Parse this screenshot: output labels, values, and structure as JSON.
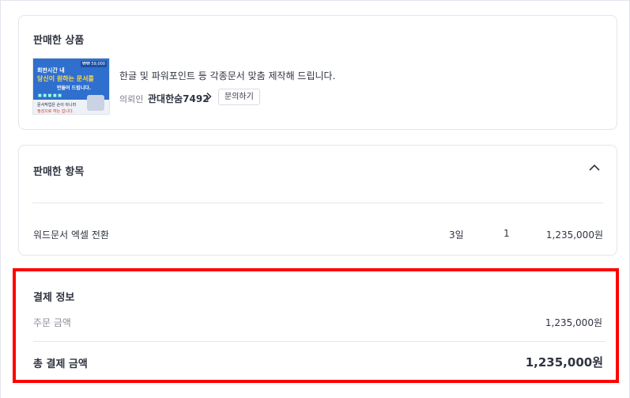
{
  "product_card": {
    "title": "판매한 상품",
    "thumbnail": {
      "price_tag": "₩₩ 59,000",
      "line1": "회판시간 내",
      "line2": "당신이 원하는 문서를",
      "line3": "만들어 드립니다.",
      "line4": "문서작업은 손이 아니라",
      "line5": "정성으로 하는 겁니다."
    },
    "description": "한글 및 파워포인트 등 각종문서 맞춤 제작해 드립니다.",
    "seller_role": "의뢰인",
    "seller_name": "관대한숨7492",
    "inquire_label": "문의하기"
  },
  "items_card": {
    "title": "판매한 항목",
    "collapse_icon": "chevron-up-icon",
    "item": {
      "name": "워드문서 엑셀 전환",
      "period": "3일",
      "quantity": "1",
      "price": "1,235,000원"
    }
  },
  "payment_card": {
    "title": "결제 정보",
    "order_label": "주문 금액",
    "order_amount": "1,235,000원",
    "total_label": "총 결제 금액",
    "total_amount": "1,235,000원",
    "highlight_color": "#ff0000"
  }
}
